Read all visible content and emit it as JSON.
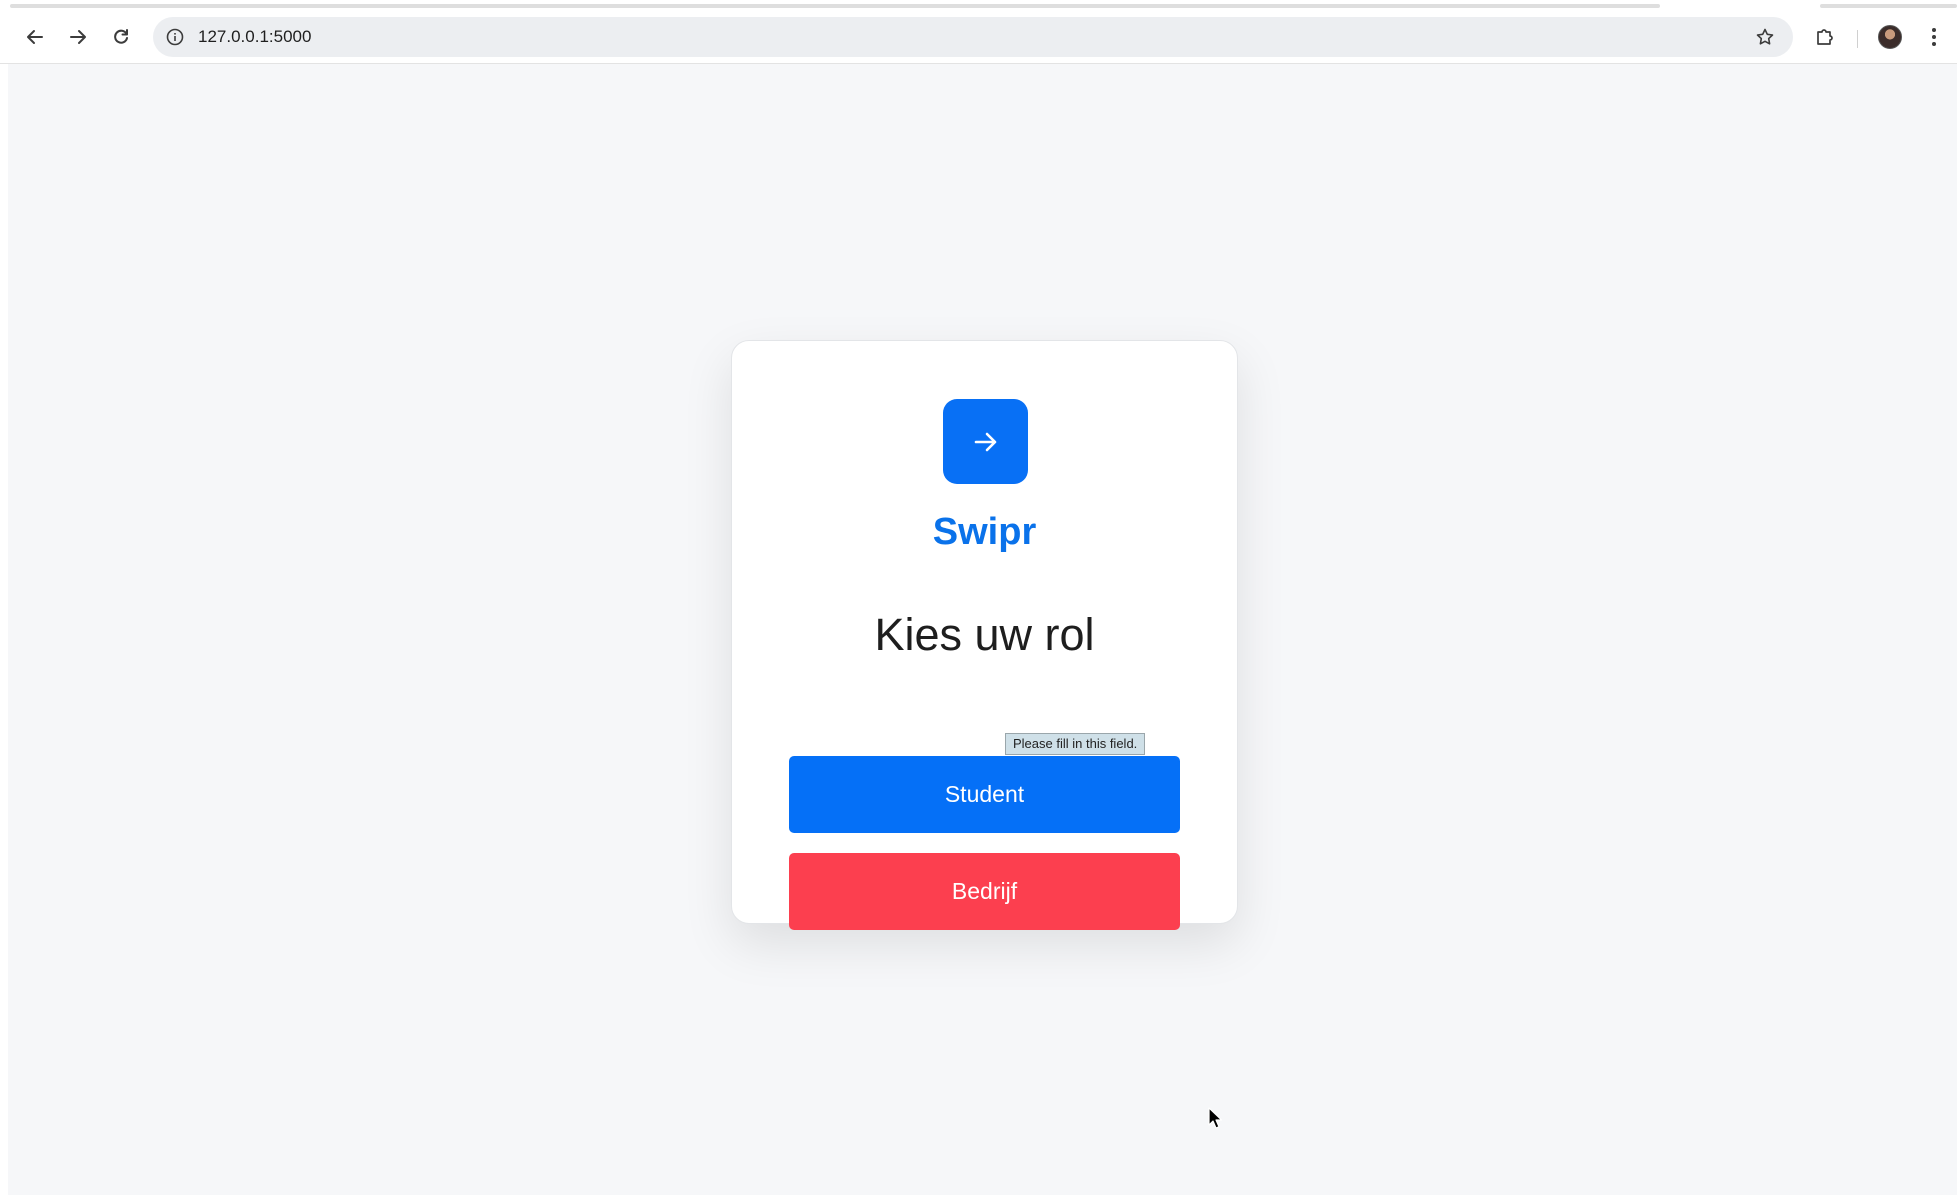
{
  "browser": {
    "url": "127.0.0.1:5000"
  },
  "app": {
    "brand": "Swipr",
    "heading": "Kies uw rol",
    "buttons": {
      "student": "Student",
      "bedrijf": "Bedrijf"
    },
    "tooltip": "Please fill in this field.",
    "colors": {
      "primary": "#0570f7",
      "danger": "#fc3f4f",
      "brand_text": "#0a72ea",
      "background": "#f6f7f9"
    }
  },
  "icons": {
    "logo": "arrow-right-icon",
    "back": "arrow-left-icon",
    "forward": "arrow-right-icon",
    "reload": "reload-icon",
    "site_info": "info-icon",
    "bookmark": "star-icon",
    "extensions": "puzzle-icon",
    "menu": "kebab-menu-icon"
  }
}
